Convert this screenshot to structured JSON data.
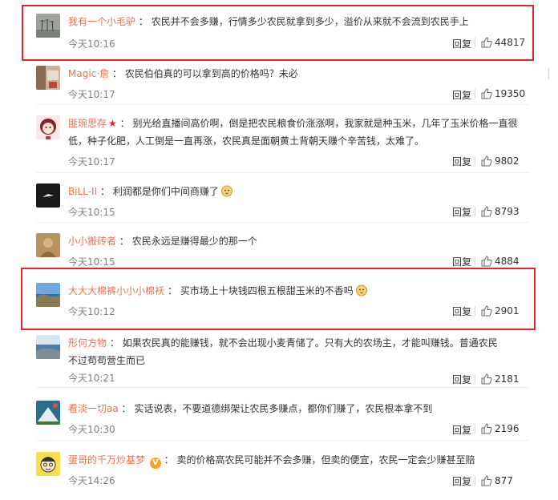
{
  "comments": [
    {
      "user": "我有一个小毛驴",
      "colon": "：",
      "text": "农民并不会多赚，行情多少农民就拿到多少，溢价从来就不会流到农民手上",
      "time": "今天10:16",
      "reply": "回复",
      "likes": "44817",
      "avatar_icon": "palm-trees-avatar-icon",
      "highlighted": true
    },
    {
      "user": "Magic·詹",
      "colon": "：",
      "text": "农民伯伯真的可以拿到高的价格吗？未必",
      "time": "今天10:17",
      "reply": "回复",
      "likes": "19350",
      "avatar_icon": "room-avatar-icon",
      "highlighted": false
    },
    {
      "user": "匪琬思存",
      "badge": "★",
      "colon": "：",
      "text": "别光给直播间高价啊，倒是把农民粮食价涨涨啊，我家就是种玉米，几年了玉米价格一直很低，种子化肥，人工倒是一直再涨，农民真是面朝黄土背朝天赚个辛苦钱，太难了。",
      "time": "今天10:17",
      "reply": "回复",
      "likes": "9802",
      "avatar_icon": "girl-cartoon-avatar-icon",
      "highlighted": false
    },
    {
      "user": "BiLL-II",
      "colon": "：",
      "text": "利润都是你们中间商赚了",
      "emoji": "doge-emoji-icon",
      "time": "今天10:15",
      "reply": "回复",
      "likes": "8793",
      "avatar_icon": "bird-dark-avatar-icon",
      "highlighted": false
    },
    {
      "user": "小小搬砖者",
      "colon": "：",
      "text": "农民永远是赚得最少的那一个",
      "time": "今天10:15",
      "reply": "回复",
      "likes": "4884",
      "avatar_icon": "portrait-avatar-icon",
      "highlighted": false
    },
    {
      "user": "大大大棉裤小小小棉袄",
      "colon": "：",
      "text": "买市场上十块钱四根五根甜玉米的不香吗",
      "emoji": "doge-emoji-icon",
      "time": "今天10:12",
      "reply": "回复",
      "likes": "2901",
      "avatar_icon": "coast-landscape-avatar-icon",
      "highlighted": true
    },
    {
      "user": "形何方物",
      "colon": "：",
      "text": "如果农民真的能赚钱，就不会出现小麦青储了。只有大的农场主，才能叫赚钱。普通农民不过苟苟营生而已",
      "time": "今天10:21",
      "reply": "回复",
      "likes": "2181",
      "avatar_icon": "seaside-avatar-icon",
      "highlighted": false
    },
    {
      "user": "看淡一切aa",
      "colon": "：",
      "text": "实话说表，不要道德绑架让农民多赚点，都你们赚了，农民根本拿不到",
      "time": "今天10:30",
      "reply": "回复",
      "likes": "2196",
      "avatar_icon": "mountain-avatar-icon",
      "highlighted": false
    },
    {
      "user": "蛋哥的千万炒基梦",
      "badge": "V",
      "colon": "：",
      "text": "卖的价格高农民可能并不会多赚，但卖的便宜，农民一定会少赚甚至赔",
      "time": "今天14:26",
      "reply": "回复",
      "likes": "877",
      "avatar_icon": "cartoon-face-avatar-icon",
      "highlighted": false
    }
  ],
  "colors": {
    "username": "#eb7350",
    "highlight_border": "#e8232b",
    "text": "#333333",
    "time": "#808080"
  }
}
